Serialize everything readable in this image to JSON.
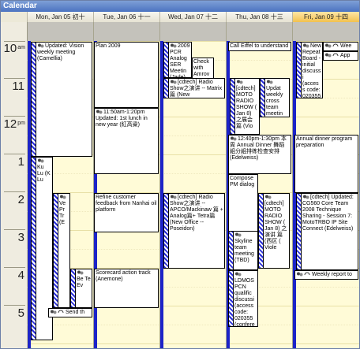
{
  "title": "Calendar",
  "days": [
    {
      "label": "Mon, Jan 05 初十"
    },
    {
      "label": "Tue, Jan 06 十一"
    },
    {
      "label": "Wed, Jan 07 十二"
    },
    {
      "label": "Thu, Jan 08 十三"
    },
    {
      "label": "Fri, Jan 09 十四"
    }
  ],
  "hours": [
    {
      "h": "10",
      "ampm": "am"
    },
    {
      "h": "11",
      "ampm": ""
    },
    {
      "h": "12",
      "ampm": "pm"
    },
    {
      "h": "1",
      "ampm": ""
    },
    {
      "h": "2",
      "ampm": ""
    },
    {
      "h": "3",
      "ampm": ""
    },
    {
      "h": "4",
      "ampm": ""
    },
    {
      "h": "5",
      "ampm": ""
    }
  ],
  "appointments": {
    "mon_vision": "Updated: Vision weekly meeting (Camellia)",
    "mon_ku": "Ku Lu (K Lu",
    "mon_ve": "Ve Pr Tr (E",
    "mon_be": "Be Te Ev",
    "mon_send": "Send th",
    "tue_plan": "Plan 2009",
    "tue_lunch": "11:50am-1:20pm Updated: 1st lunch in new year (紅高粱)",
    "tue_refine": "Refine customer feedback from Nanhai oil platform",
    "tue_scorecard": "Scorecard action track (Anemone)",
    "wed_pcr": "2009 PCR Analog SER Meetin (Jade)",
    "wed_check": "Check with Amrov",
    "wed_radio1": "[cdtech] Radio Show之演讲 -- Matrix 篇 (New",
    "wed_radio2": "[cdtech] Radio Show之演讲 -- APCO/Mackinaw 篇 + Analog篇+ Tetra篇 (New Office -- Poseidon)",
    "thu_eiffel": "Call Eiffel to understand",
    "thu_moto1": "[cdtech] MOTO RADIO SHOW ( Jan 8) 之展会 篇 (Vio",
    "thu_update": "Updat weekly cross team meetin (CD",
    "thu_dinner": "12:40pm-1:30pm 本周 Annual Dinner 舞蹈組分組排练检查安排 (Edelweiss)",
    "thu_compose": "Compose PM dialog",
    "thu_moto2": "[cdtech] MOTO RADIO SHOW ( Jan 8) 之演讲 篇 (西区 ( Viole",
    "thu_skyline": "Skyline team meeting (TBD)",
    "thu_ldmos": "LDMOS PCN qualific discussi (access code: 020355 (confere",
    "fri_new": "New Repeat Board - initial discussi (access code: 020355 (Magn",
    "fri_wee": "Wee",
    "fri_app": "App",
    "fri_dinnerprep": "Annual dinner program preparation",
    "fri_cg560": "[cdtech] Updated: CG560 Core Team 2008 Technique Sharing - Session 7: MotoTRBO IP Site Connect (Edelweiss)",
    "fri_weekly": "Weekly report to"
  }
}
